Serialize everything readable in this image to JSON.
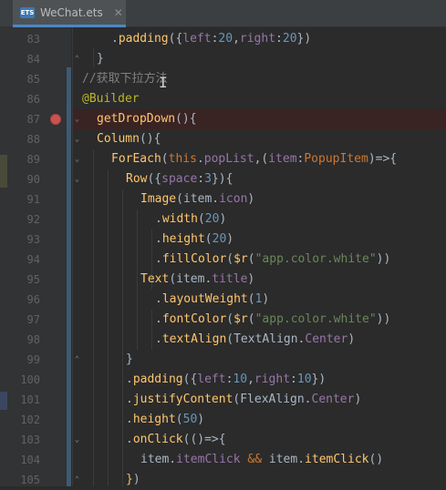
{
  "tab": {
    "icon_text": "ETS",
    "filename": "WeChat.ets",
    "close_glyph": "✕"
  },
  "lines": [
    {
      "n": "83",
      "code": "    .padding({left:20,right:20})"
    },
    {
      "n": "84",
      "code": "  }"
    },
    {
      "n": "85",
      "code": "//获取下拉方法"
    },
    {
      "n": "86",
      "code": "@Builder"
    },
    {
      "n": "87",
      "code": "  getDropDown(){"
    },
    {
      "n": "88",
      "code": "  Column(){"
    },
    {
      "n": "89",
      "code": "    ForEach(this.popList,(item:PopupItem)=>{"
    },
    {
      "n": "90",
      "code": "      Row({space:3}){"
    },
    {
      "n": "91",
      "code": "        Image(item.icon)"
    },
    {
      "n": "92",
      "code": "          .width(20)"
    },
    {
      "n": "93",
      "code": "          .height(20)"
    },
    {
      "n": "94",
      "code": "          .fillColor($r(\"app.color.white\"))"
    },
    {
      "n": "95",
      "code": "        Text(item.title)"
    },
    {
      "n": "96",
      "code": "          .layoutWeight(1)"
    },
    {
      "n": "97",
      "code": "          .fontColor($r(\"app.color.white\"))"
    },
    {
      "n": "98",
      "code": "          .textAlign(TextAlign.Center)"
    },
    {
      "n": "99",
      "code": "      }"
    },
    {
      "n": "100",
      "code": "      .padding({left:10,right:10})"
    },
    {
      "n": "101",
      "code": "      .justifyContent(FlexAlign.Center)"
    },
    {
      "n": "102",
      "code": "      .height(50)"
    },
    {
      "n": "103",
      "code": "      .onClick(()=>{"
    },
    {
      "n": "104",
      "code": "        item.itemClick && item.itemClick()"
    },
    {
      "n": "105",
      "code": "      })"
    }
  ],
  "colors": {
    "background": "#2b2b2b",
    "keyword": "#cc7832",
    "function": "#ffc66d",
    "number": "#6897bb",
    "string": "#6a8759",
    "comment": "#808080",
    "annotation": "#bbb529",
    "breakpoint": "#c75450"
  }
}
